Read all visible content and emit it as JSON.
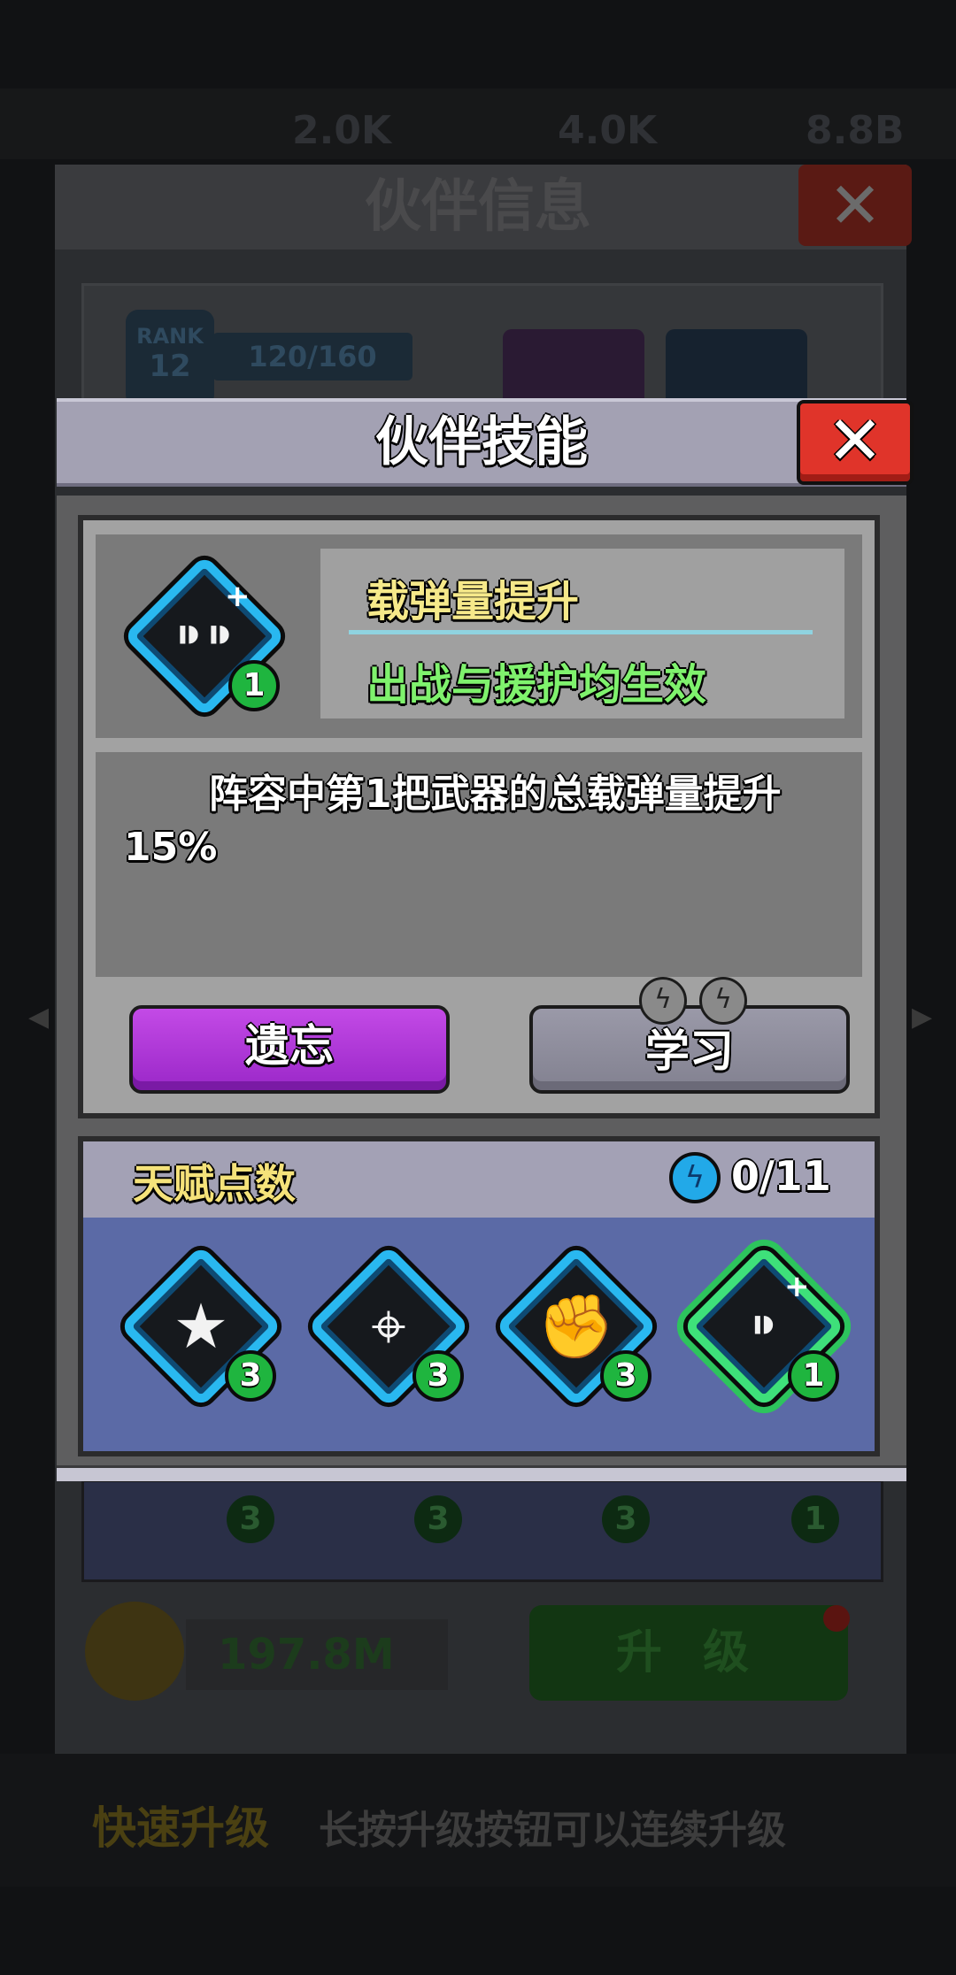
{
  "background": {
    "resources": [
      "2.0K",
      "4.0K",
      "8.8B"
    ],
    "window_title": "伙伴信息",
    "rank_label": "RANK",
    "rank_value": "12",
    "rank_progress": "120/160",
    "talent_levels": [
      "3",
      "3",
      "3",
      "1"
    ],
    "coins": "197.8M",
    "upgrade_label": "升 级",
    "tip_title": "快速升级",
    "tip_text": "长按升级按钮可以连续升级"
  },
  "modal": {
    "title": "伙伴技能",
    "close_label": "✕",
    "skill": {
      "icon": "bullets-icon",
      "level": "1",
      "name": "载弹量提升",
      "effect": "出战与援护均生效",
      "description": "阵容中第1把武器的总载弹量提升15%"
    },
    "buttons": {
      "forget": "遗忘",
      "learn": "学习"
    },
    "talent": {
      "title": "天赋点数",
      "count": "0/11",
      "skills": [
        {
          "icon": "star-chain-icon",
          "glyph": "★",
          "level": "3"
        },
        {
          "icon": "crosshair-icon",
          "glyph": "⌖",
          "level": "3"
        },
        {
          "icon": "fist-icon",
          "glyph": "✊",
          "level": "3"
        },
        {
          "icon": "bullets-icon",
          "glyph": "⁍",
          "level": "1"
        }
      ]
    }
  },
  "colors": {
    "accent_blue": "#29b8f0",
    "accent_green": "#3ee07a",
    "forget_purple": "#b43fe0",
    "close_red": "#e0342a"
  }
}
